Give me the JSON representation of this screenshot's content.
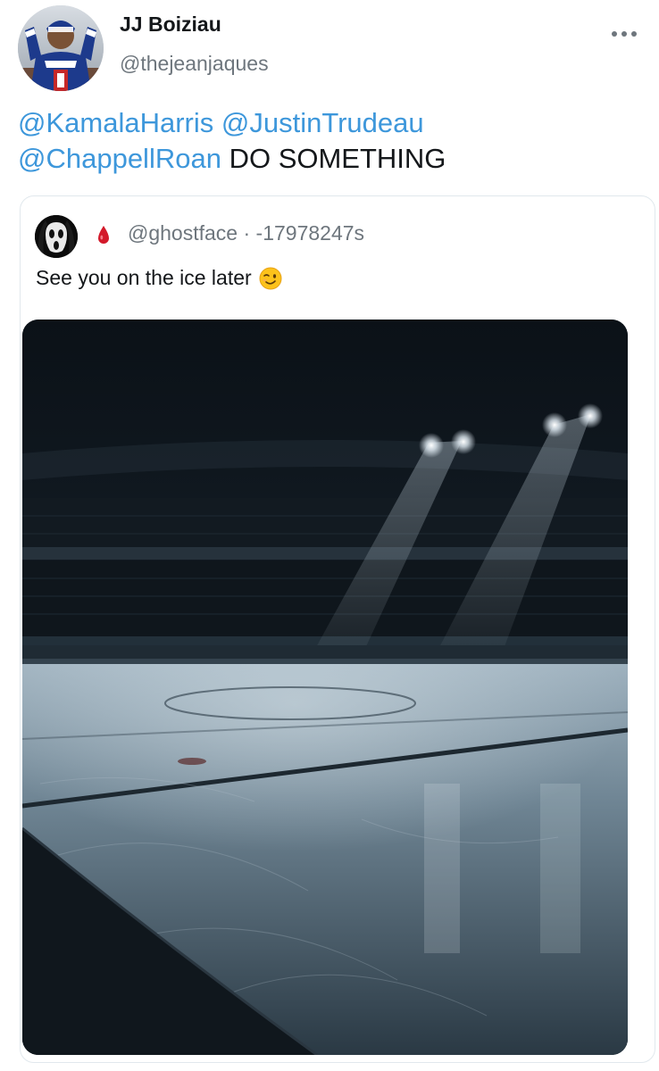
{
  "tweet": {
    "author": {
      "name": "JJ Boiziau",
      "handle": "@thejeanjaques",
      "avatar_icon": "avatar-hockey-player"
    },
    "more_icon": "ellipsis-icon",
    "text": {
      "mentions": [
        "@KamalaHarris",
        "@JustinTrudeau",
        "@ChappellRoan"
      ],
      "trailing": "DO SOMETHING"
    },
    "colors": {
      "mention": "#3d97db",
      "muted": "#6e767d",
      "border": "#e1e8ed"
    }
  },
  "quoted_tweet": {
    "avatar_icon": "ghostface-mask",
    "badge_icon": "blood-drop-icon",
    "handle": "@ghostface",
    "separator": " · ",
    "timestamp": "-17978247s",
    "text": "See you on the ice later",
    "emoji_icon": "winking-face-icon",
    "media": {
      "kind": "image",
      "subject": "empty-ice-rink-spotlights"
    }
  }
}
